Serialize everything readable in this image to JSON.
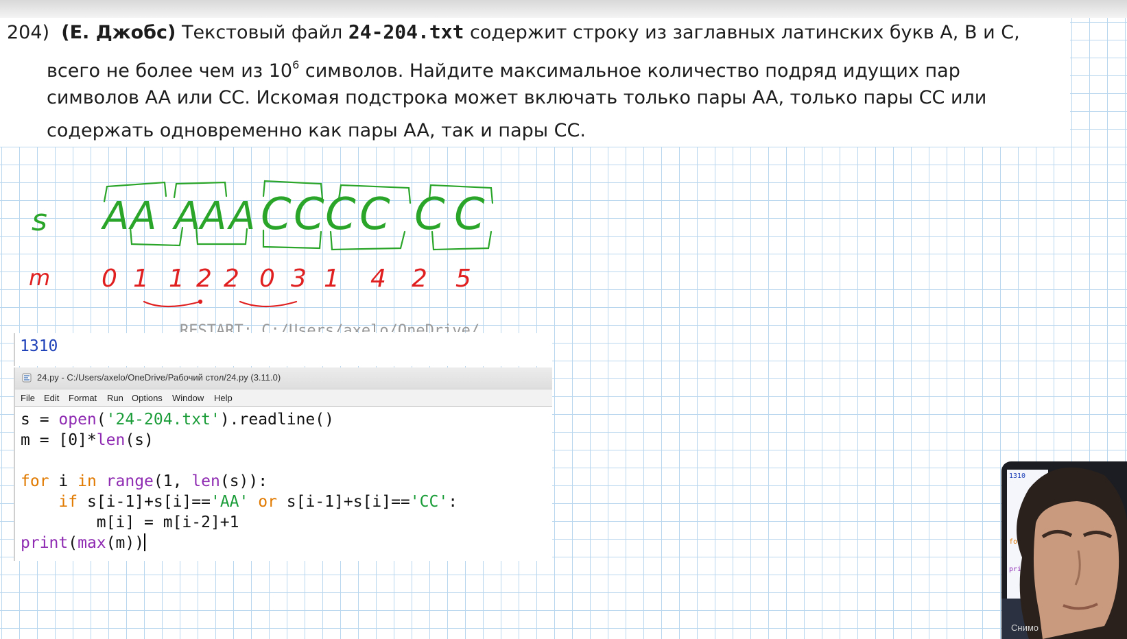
{
  "task": {
    "number": "204)",
    "author": "(Е. Джобс)",
    "line1_pre": "Текстовый файл",
    "filename": "24-204.txt",
    "line1_post": "содержит строку из заглавных латинских букв A, B и C,",
    "line2_pre": "всего не более чем из 10",
    "line2_sup": "6",
    "line2_post": "символов. Найдите максимальное количество подряд идущих пар",
    "line3": "символов AA или CC. Искомая подстрока может включать только пары AA, только пары CC или",
    "line4": "содержать одновременно как пары AA, так и пары CC."
  },
  "drawing": {
    "label_s": "s",
    "label_m": "m",
    "letters": [
      "A",
      "A",
      "A",
      "A",
      "A",
      "C",
      "C",
      "C",
      "C",
      "C",
      "C"
    ],
    "m_values": [
      "0",
      "1",
      "1",
      "2",
      "2",
      "0",
      "3",
      "1",
      "4",
      "2",
      "5"
    ],
    "colors": {
      "green": "#2aa52a",
      "red": "#e02020"
    }
  },
  "shell": {
    "output": "1310",
    "partial_text": "RESTART: C:/Users/axelo/OneDrive/..."
  },
  "editor": {
    "title": "24.py - C:/Users/axelo/OneDrive/Рабочий стол/24.py (3.11.0)",
    "menu": [
      "File",
      "Edit",
      "Format",
      "Run",
      "Options",
      "Window",
      "Help"
    ],
    "code": {
      "l1_a": "s = ",
      "l1_open": "open",
      "l1_b": "(",
      "l1_str": "'24-204.txt'",
      "l1_c": ").readline()",
      "l2_a": "m = [0]*",
      "l2_len": "len",
      "l2_b": "(s)",
      "l4_for": "for",
      "l4_a": " i ",
      "l4_in": "in",
      "l4_sp": " ",
      "l4_range": "range",
      "l4_b": "(1, ",
      "l4_len": "len",
      "l4_c": "(s)):",
      "l5_indent": "    ",
      "l5_if": "if",
      "l5_a": " s[i-1]+s[i]==",
      "l5_aa": "'AA'",
      "l5_sp": " ",
      "l5_or": "or",
      "l5_b": " s[i-1]+s[i]==",
      "l5_cc": "'CC'",
      "l5_c": ":",
      "l6": "        m[i] = m[i-2]+1",
      "l7_print": "print",
      "l7_a": "(",
      "l7_max": "max",
      "l7_b": "(m))"
    }
  },
  "webcam": {
    "mini_lines": [
      "1310",
      "fo",
      "print"
    ],
    "taskbar_text": "Снимо"
  }
}
